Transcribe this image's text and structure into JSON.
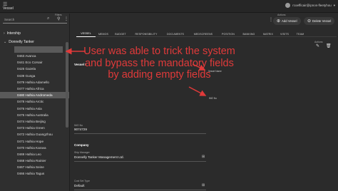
{
  "app": {
    "title": "Vessel",
    "user": "rcoefficair@ipnos-fleetyhou"
  },
  "search": {
    "label": "Search",
    "filters_label": "Filters"
  },
  "tree": {
    "groups": [
      {
        "label": "Intership",
        "expanded": false
      },
      {
        "label": "Donnelly Tanker",
        "expanded": true
      }
    ],
    "items": [
      "",
      "0463 Avanca",
      "0441 Eco Corsair",
      "0425 Gazela",
      "0439 Gunga",
      "0479 Hafnia Adamello",
      "0477 Hafnia Africa",
      "0480 Hafnia Andromeda",
      "0478 Hafnia Arctic",
      "0476 Hafnia Asia",
      "0475 Hafnia Australia",
      "0474 Hafnia Beijing",
      "0473 Hafnia Green",
      "0472 Hafnia Guangzhou",
      "0471 Hafnia Hope",
      "0470 Hafnia Karava",
      "0469 Hafnia Leo",
      "0468 Hafnia Rainier",
      "0467 Hafnia Seine",
      "0466 Hafnia Tagus"
    ],
    "selected_index": 7
  },
  "toolbar": {
    "actions_label": "Actions",
    "add_label": "Add Vessel",
    "delete_label": "Delete Vessel"
  },
  "tabs": [
    "VESSEL",
    "MEMOS",
    "BUDGET",
    "RESPONSIBILITY",
    "DOCUMENTS",
    "MEDSCREENS",
    "POSITION",
    "BANKING",
    "MATRIX",
    "VISITS",
    "TEAM"
  ],
  "active_tab": "VESSEL",
  "detail": {
    "actions_label": "Actions",
    "vessel_section": "Vessel I",
    "vessel_name_label": "Vessel Name",
    "imo_note": "IMO No",
    "imo_label": "IMO No",
    "imo_value": "9074729",
    "company_section": "Company",
    "ship_manager_label": "Ship Manager",
    "ship_manager_value": "Donnelly Tanker Management Ltd.",
    "cost_set_label": "Cost Set Type",
    "cost_set_value": "Default"
  },
  "annotation": {
    "text": "User was able to trick the system and bypass the mandatory fields by adding empty fields",
    "color": "#e03a3a"
  }
}
